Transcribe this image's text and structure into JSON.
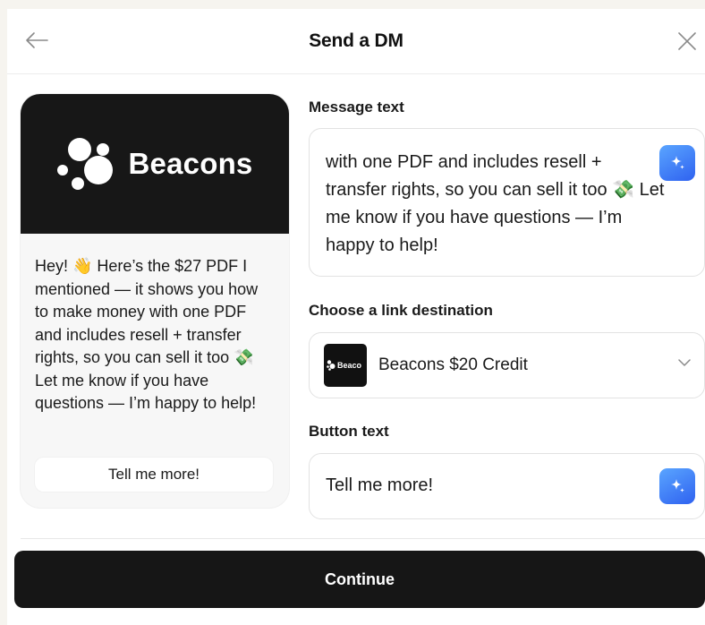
{
  "header": {
    "title": "Send a DM",
    "back_icon": "arrow-left-icon",
    "close_icon": "close-icon"
  },
  "preview": {
    "brand_name": "Beacons",
    "message": "Hey! 👋 Here’s the $27 PDF I mentioned — it shows you how to make money with one PDF and includes resell + transfer rights, so you can sell it too 💸 Let me know if you have questions — I’m happy to help!",
    "button_label": "Tell me more!"
  },
  "form": {
    "message_label": "Message text",
    "message_value": "with one PDF and includes resell + transfer rights, so you can sell it too 💸 Let me know if you have questions — I’m happy to help!",
    "link_label": "Choose a link destination",
    "link_thumb_text": "Beaco",
    "link_value": "Beacons $20 Credit",
    "button_label": "Button text",
    "button_value": "Tell me more!"
  },
  "actions": {
    "continue_label": "Continue"
  },
  "colors": {
    "background": "#f6f4ef",
    "dark": "#161616",
    "ai_accent": "#2f62f0"
  }
}
